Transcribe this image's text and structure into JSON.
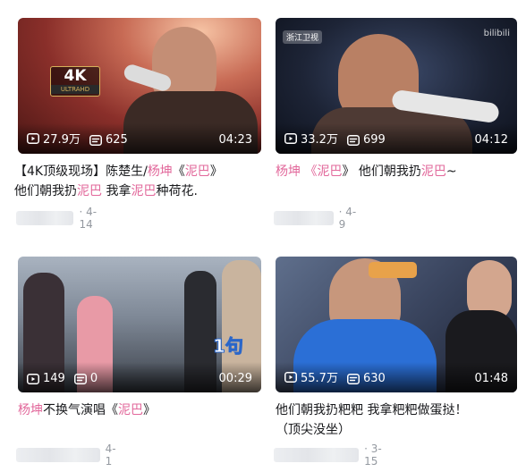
{
  "videos": [
    {
      "views": "27.9万",
      "comments": "625",
      "duration": "04:23",
      "badge_main": "4K",
      "badge_sub": "ULTRAHD",
      "title_parts": [
        "【4K顶级现场】陈楚生/",
        "杨坤",
        "《",
        "泥巴",
        "》"
      ],
      "title_line2_parts": [
        "他们朝我扔",
        "泥巴",
        " 我拿",
        "泥巴",
        "种荷花."
      ],
      "date": "· 4-14"
    },
    {
      "views": "33.2万",
      "comments": "699",
      "duration": "04:12",
      "channel_logo": "浙江卫视",
      "corner_logo": "bilibili",
      "title_parts": [
        "杨坤",
        " 《",
        "泥巴",
        "》 他们朝我扔",
        "泥巴",
        "~"
      ],
      "date": "· 4-9"
    },
    {
      "views": "149",
      "comments": "0",
      "duration": "00:29",
      "overlay_text": "1句",
      "title_parts": [
        "杨坤",
        "不换气演唱《",
        "泥巴",
        "》"
      ],
      "date": "4-1"
    },
    {
      "views": "55.7万",
      "comments": "630",
      "duration": "01:48",
      "title_line1": "他们朝我扔粑粑 我拿粑粑做蛋挞！",
      "title_line2": "（顶尖没坐）",
      "date": "· 3-15"
    }
  ],
  "colors": {
    "highlight": "#e2689b",
    "meta": "#9499a0",
    "text": "#18191c"
  },
  "icons": {
    "views": "play-count-icon",
    "comments": "danmaku-icon"
  }
}
